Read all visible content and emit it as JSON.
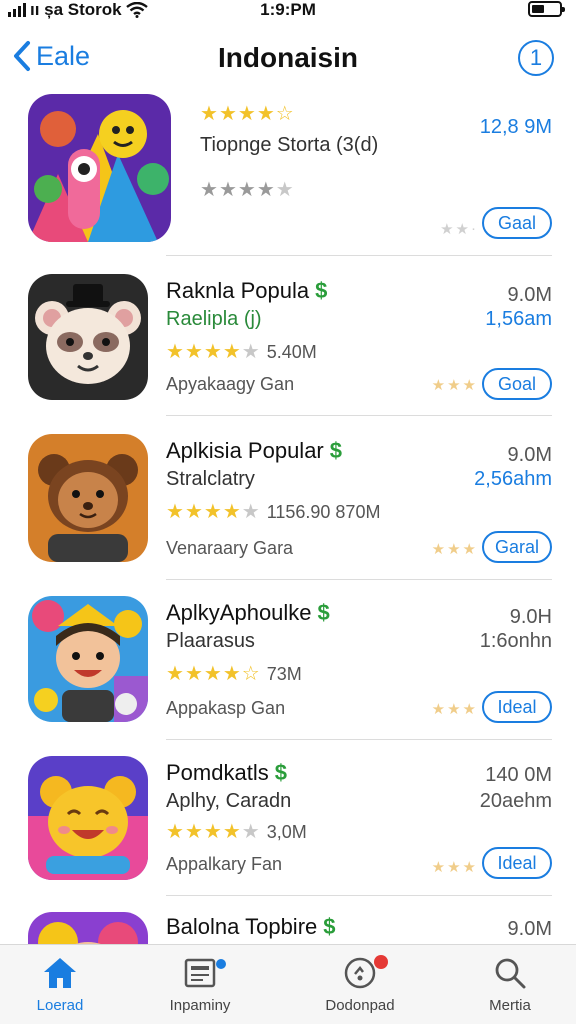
{
  "status_bar": {
    "carrier": "ıı șa Storok",
    "time": "1:9:PM"
  },
  "nav": {
    "back_label": "Eale",
    "title": "Indonaisin",
    "info_label": "1"
  },
  "apps": [
    {
      "name": "",
      "subtitle": "Tiopnge Storta (3(d)",
      "category": "",
      "rating_text": "",
      "size": "12,8 9M",
      "size2": "",
      "button": "Gaal",
      "has_dollar": false,
      "icon": "monster-party-icon",
      "accent": "#6a2fb8"
    },
    {
      "name": "Raknla Popula",
      "subtitle": "Raelipla (j)",
      "category": "Apyakaagy Gan",
      "rating_text": "5.40M",
      "size": "9.0M",
      "size2": "1,56am",
      "button": "Goal",
      "has_dollar": true,
      "icon": "panda-icon",
      "accent": "#2c2c2c"
    },
    {
      "name": "Aplkisia Popular",
      "subtitle": "Stralclatry",
      "category": "Venaraary Gara",
      "rating_text": "1156.90 870M",
      "size": "9.0M",
      "size2": "2,56ahm",
      "button": "Garal",
      "has_dollar": true,
      "icon": "bear-icon",
      "accent": "#d9852a"
    },
    {
      "name": "AplkyAphoulke",
      "subtitle": "Plaarasus",
      "category": "Appakasp Gan",
      "rating_text": "73M",
      "size": "9.0H",
      "size2": "1:6onhn",
      "button": "Ideal",
      "has_dollar": true,
      "icon": "kid-character-icon",
      "accent": "#3aa0e0"
    },
    {
      "name": "Pomdkatls",
      "subtitle": "Aplhy, Caradn",
      "category": "Appalkary Fan",
      "rating_text": "3,0M",
      "size": "140 0M",
      "size2": "20aehm",
      "button": "Ideal",
      "has_dollar": true,
      "icon": "emoji-face-icon",
      "accent": "#f0b020"
    },
    {
      "name": "Balolna Topbire",
      "subtitle": "",
      "category": "",
      "rating_text": "",
      "size": "9.0M",
      "size2": "",
      "button": "",
      "has_dollar": true,
      "icon": "partial-app-icon",
      "accent": "#8a3fd0"
    }
  ],
  "tabs": [
    {
      "label": "Loerad",
      "icon": "home-icon",
      "active": true
    },
    {
      "label": "Inpaminy",
      "icon": "news-icon",
      "active": false
    },
    {
      "label": "Dodonpad",
      "icon": "games-icon",
      "active": false
    },
    {
      "label": "Mertia",
      "icon": "search-icon",
      "active": false
    }
  ],
  "colors": {
    "accent": "#1a7de0",
    "star": "#f2c22a",
    "dollar": "#2a9d3a",
    "badge_blue": "#1a7de0",
    "badge_red": "#e53935"
  }
}
